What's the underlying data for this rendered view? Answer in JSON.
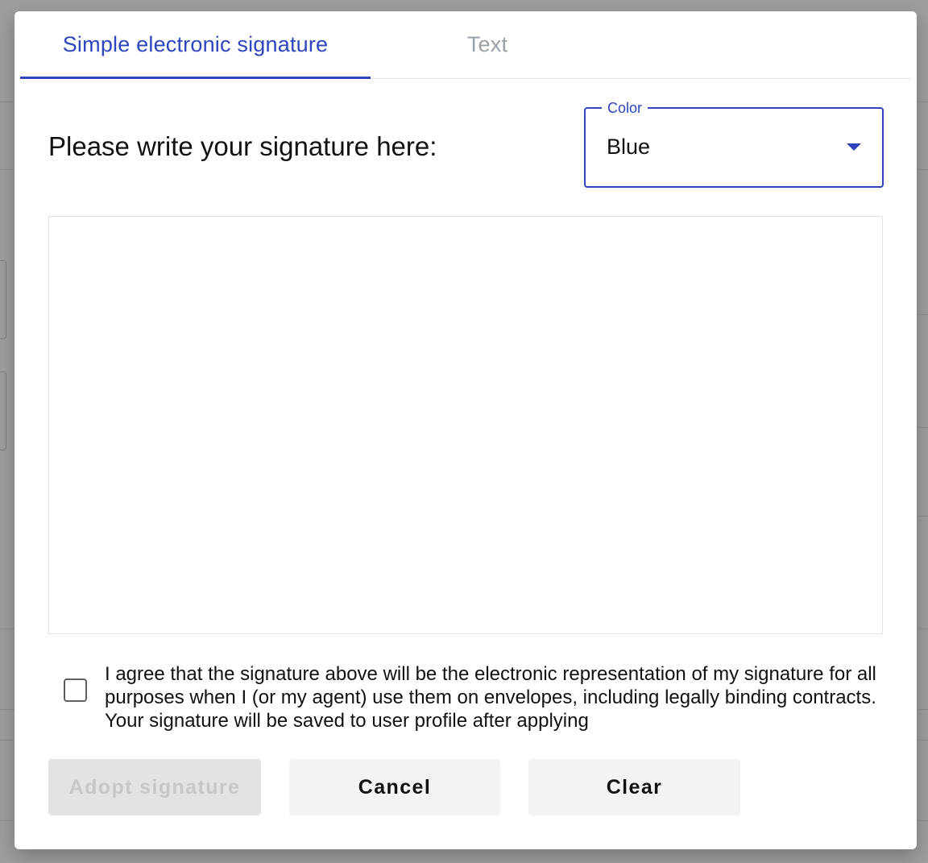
{
  "tabs": [
    {
      "label": "Simple electronic signature",
      "active": true
    },
    {
      "label": "Text",
      "active": false
    }
  ],
  "signature_pad": {
    "heading": "Please write your signature here:",
    "color_select": {
      "label": "Color",
      "value": "Blue"
    }
  },
  "agreement": {
    "text": "I agree that the signature above will be the electronic representation of my signature for all purposes when I (or my agent) use them on envelopes, including legally binding contracts. Your signature will be saved to user profile after applying",
    "checked": false
  },
  "buttons": {
    "adopt_label": "Adopt signature",
    "adopt_disabled": true,
    "cancel_label": "Cancel",
    "clear_label": "Clear"
  },
  "colors": {
    "accent": "#2f45bd",
    "inactive_tab": "#9aa0a8",
    "backdrop": "#9e9e9e"
  }
}
